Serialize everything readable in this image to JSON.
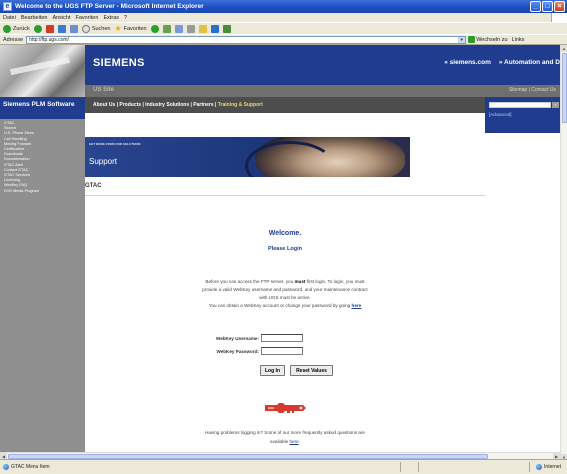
{
  "window": {
    "title": "Welcome to the UGS FTP Server - Microsoft Internet Explorer",
    "controls": {
      "minimize": "_",
      "maximize": "□",
      "close": "×"
    }
  },
  "menu": [
    "Datei",
    "Bearbeiten",
    "Ansicht",
    "Favoriten",
    "Extras",
    "?"
  ],
  "toolbar": {
    "back": "Zurück",
    "search": "Suchen",
    "favorites": "Favoriten"
  },
  "address": {
    "label": "Adresse",
    "url": "http://ftp.ugs.com/",
    "go": "Wechseln zu",
    "links": "Links"
  },
  "site": {
    "brand": "SIEMENS",
    "top_links": [
      "» siemens.com",
      "» Automation and D"
    ],
    "us_site": "US Site",
    "sitemap": "Sitemap | Contact Us",
    "left_header": "Siemens PLM Software",
    "left_items": [
      "GTAC",
      "Search",
      "U.S. Phone Menu",
      "Call Handling",
      "Moving Forward",
      "Certification",
      "Downloads",
      "Documentation",
      "GTAC Alert",
      "Contact GTAC",
      "GTAC Services",
      "Licensing",
      "WebKey FAQ",
      "DVD Media Program"
    ],
    "nav_items": "About Us | Products | Industry Solutions | Partners | ",
    "nav_highlight": "Training & Support",
    "advanced": "[Advanced]",
    "banner_caption": "GET MORE FROM OUR SOLUTIONS",
    "banner_title": "Support",
    "section": "GTAC"
  },
  "login": {
    "welcome": "Welcome.",
    "please": "Please Login",
    "para_a": "Before you can access the FTP server, you ",
    "para_must": "must",
    "para_b": " first login. To login, you must",
    "para_c": "provide a valid WebKey username and password, and your maintenance contract",
    "para_d": "with UGS must be active.",
    "para_e": "You can obtain a WebKey account or change your password by going ",
    "here": "here",
    "username_label": "WebKey Username:",
    "password_label": "WebKey Password:",
    "login_btn": "Log In",
    "reset_btn": "Reset Values",
    "help_a": "Having problems logging in? Some of our more frequently asked questions are",
    "help_b": "available ",
    "help_here": "here",
    "help_dot": "."
  },
  "status": {
    "text": "GTAC Menu Item",
    "zone": "Internet"
  },
  "colors": {
    "brand_blue": "#1f3c8f",
    "nav_grey": "#4d4d4d",
    "highlight": "#e9d870",
    "key_red": "#d63a2f"
  },
  "icons": [
    "ie-icon",
    "back-icon",
    "forward-icon",
    "stop-icon",
    "refresh-icon",
    "home-icon",
    "search-icon",
    "favorites-icon",
    "media-icon",
    "history-icon",
    "mail-icon",
    "print-icon",
    "edit-icon",
    "go-icon",
    "key-icon",
    "globe-icon"
  ]
}
